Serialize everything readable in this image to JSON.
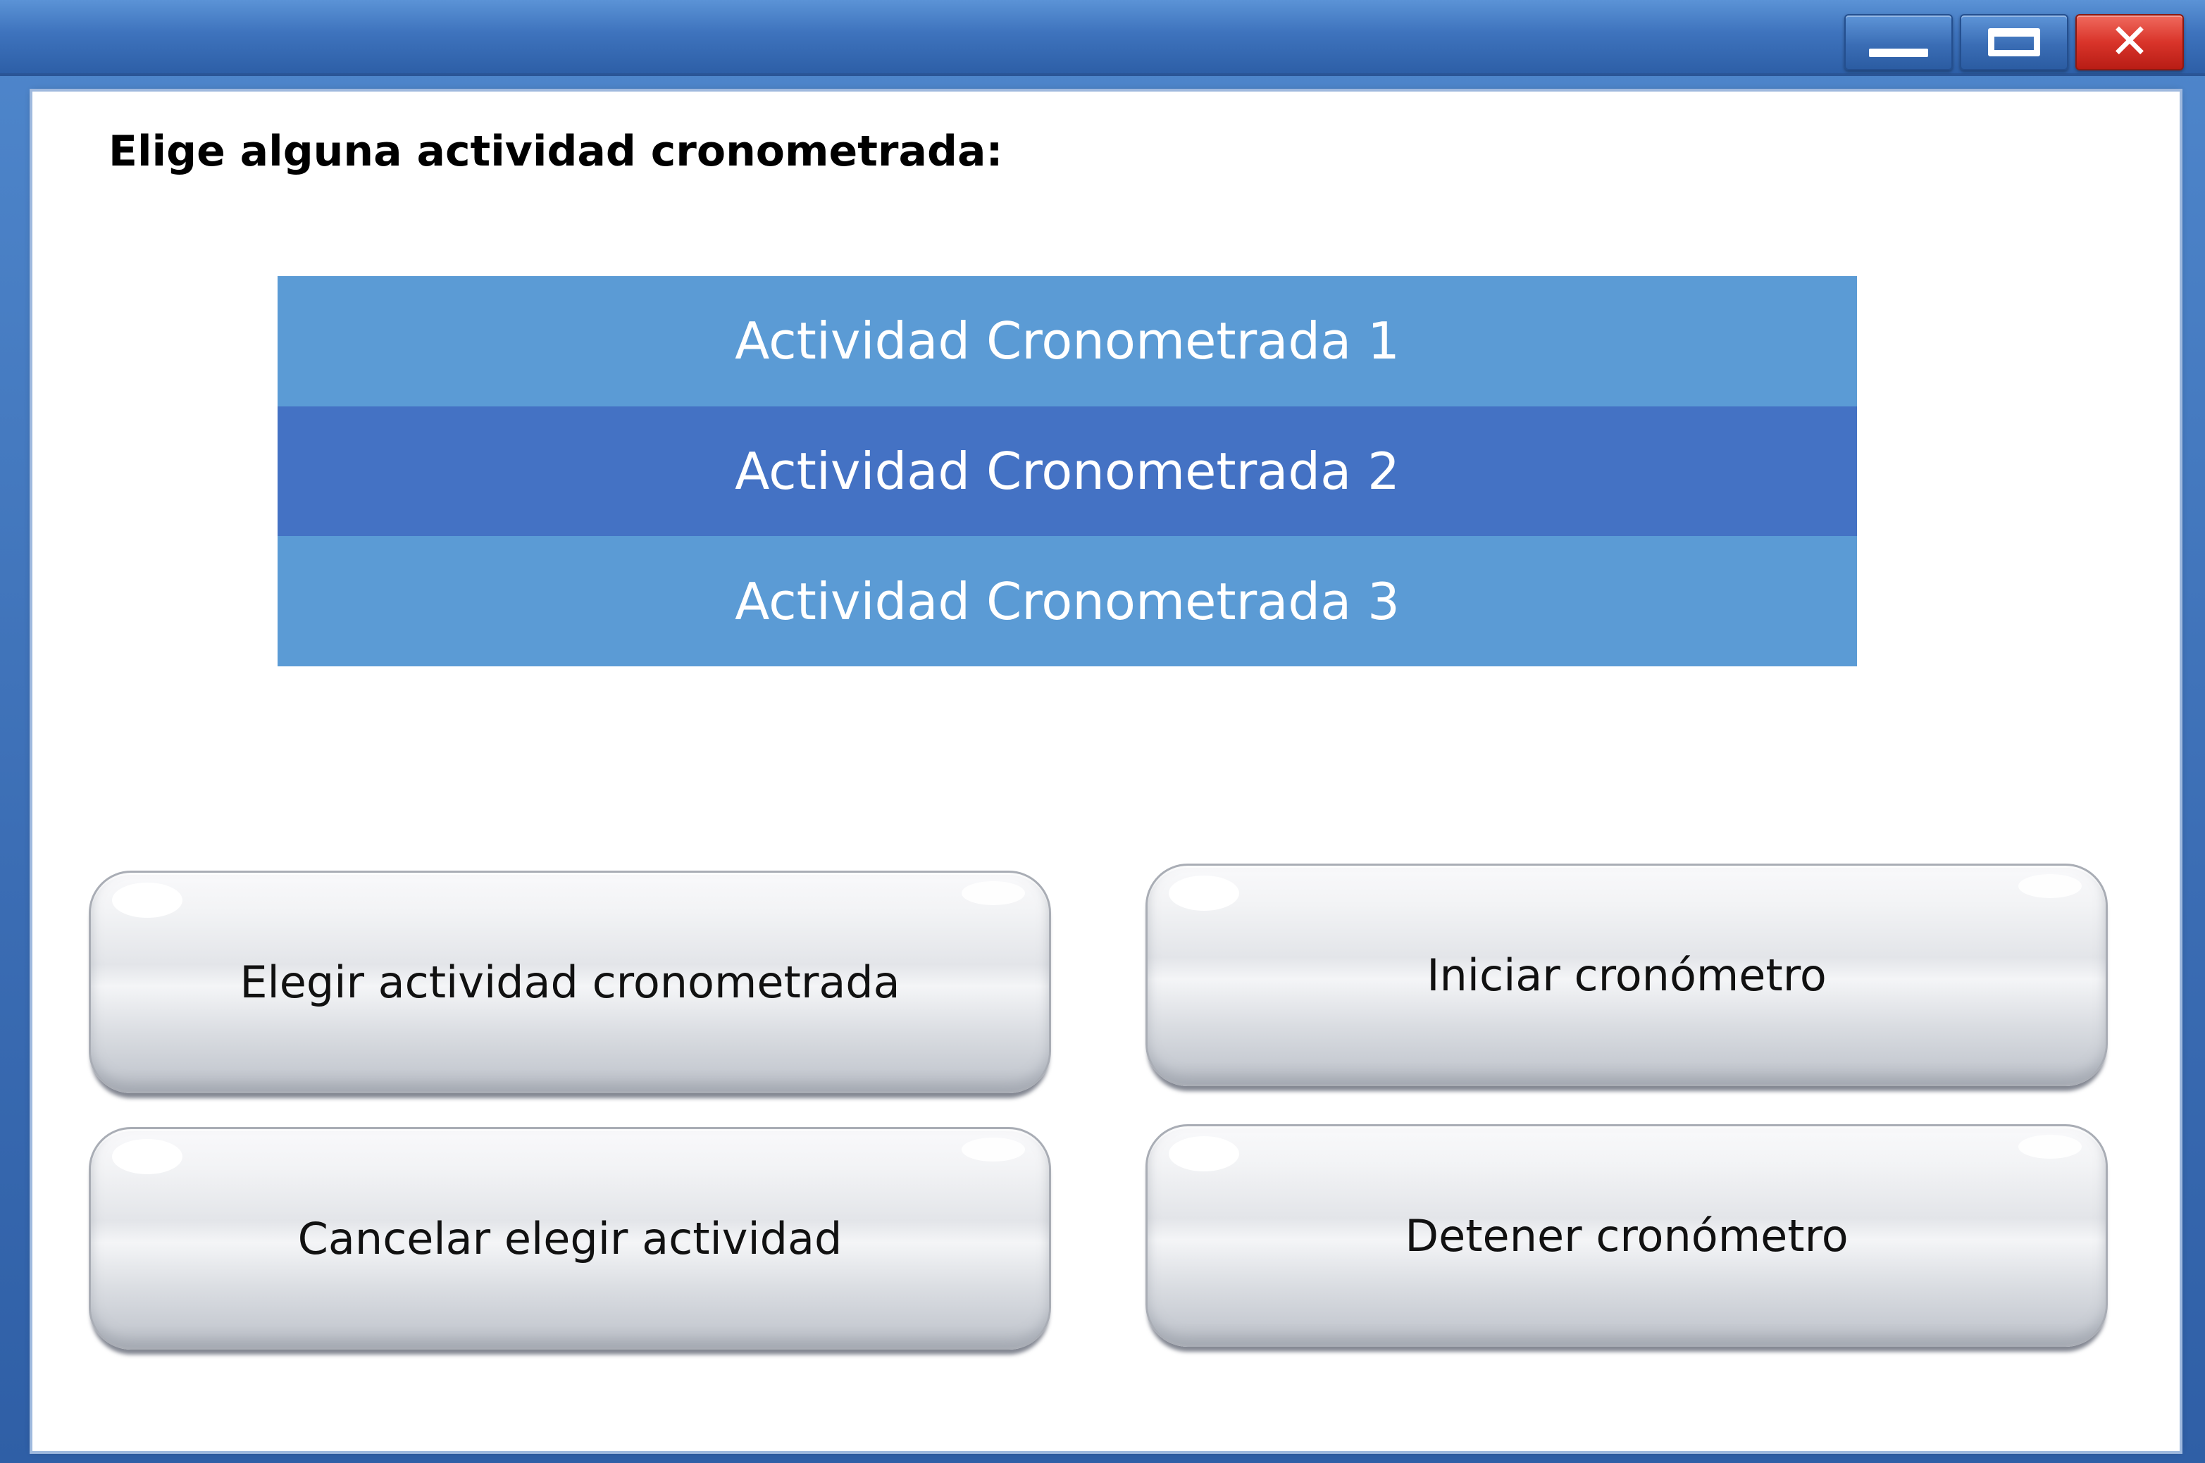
{
  "window": {
    "controls": {
      "minimize_icon": "minimize-icon",
      "maximize_icon": "maximize-icon",
      "close_icon": "close-icon",
      "close_glyph": "✕"
    },
    "colors": {
      "frame": "#3f72b8",
      "list_item": "#5b9bd5",
      "list_item_selected": "#4472c4",
      "close_button": "#d9342a"
    }
  },
  "content": {
    "prompt": "Elige alguna actividad cronometrada:",
    "activities": [
      {
        "label": "Actividad Cronometrada 1",
        "selected": false
      },
      {
        "label": "Actividad Cronometrada 2",
        "selected": true
      },
      {
        "label": "Actividad Cronometrada 3",
        "selected": false
      }
    ],
    "buttons": {
      "choose": "Elegir actividad cronometrada",
      "start": "Iniciar cronómetro",
      "cancel": "Cancelar elegir actividad",
      "stop": "Detener cronómetro"
    }
  }
}
